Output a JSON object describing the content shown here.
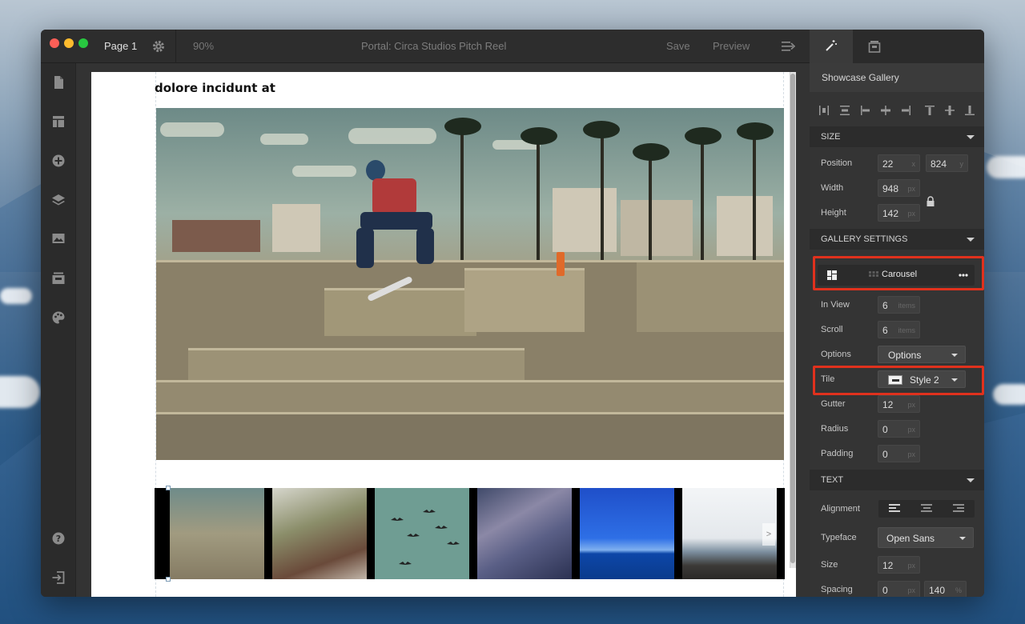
{
  "window": {
    "page_label": "Page 1",
    "zoom": "90%",
    "title": "Portal: Circa Studios Pitch Reel",
    "save_label": "Save",
    "preview_label": "Preview"
  },
  "canvas": {
    "heading": "dolore incidunt at",
    "carousel_next_arrow": ">"
  },
  "toolrail": {
    "icons": [
      "page-icon",
      "layout-icon",
      "add-icon",
      "layers-icon",
      "image-icon",
      "media-icon",
      "palette-icon",
      "help-icon",
      "exit-icon"
    ]
  },
  "panel": {
    "title": "Showcase Gallery",
    "size_section": "SIZE",
    "position_label": "Position",
    "position_x": "22",
    "position_x_unit": "x",
    "position_y": "824",
    "position_y_unit": "y",
    "width_label": "Width",
    "width_value": "948",
    "width_unit": "px",
    "height_label": "Height",
    "height_value": "142",
    "height_unit": "px",
    "gallery_section": "GALLERY SETTINGS",
    "layout_mode": "Carousel",
    "in_view_label": "In View",
    "in_view_value": "6",
    "in_view_unit": "items",
    "scroll_label": "Scroll",
    "scroll_value": "6",
    "scroll_unit": "items",
    "options_label": "Options",
    "options_value": "Options",
    "tile_label": "Tile",
    "tile_value": "Style 2",
    "gutter_label": "Gutter",
    "gutter_value": "12",
    "gutter_unit": "px",
    "radius_label": "Radius",
    "radius_value": "0",
    "radius_unit": "px",
    "padding_label": "Padding",
    "padding_value": "0",
    "padding_unit": "px",
    "text_section": "TEXT",
    "alignment_label": "Alignment",
    "typeface_label": "Typeface",
    "typeface_value": "Open Sans",
    "size_label": "Size",
    "size_value": "12",
    "size_unit": "px",
    "spacing_label": "Spacing",
    "spacing_value": "0",
    "spacing_unit": "px",
    "line_height_value": "140",
    "line_height_unit": "%"
  },
  "colors": {
    "highlight": "#e0311d",
    "panel_bg": "#343434",
    "window_bg": "#2a2a2a"
  }
}
